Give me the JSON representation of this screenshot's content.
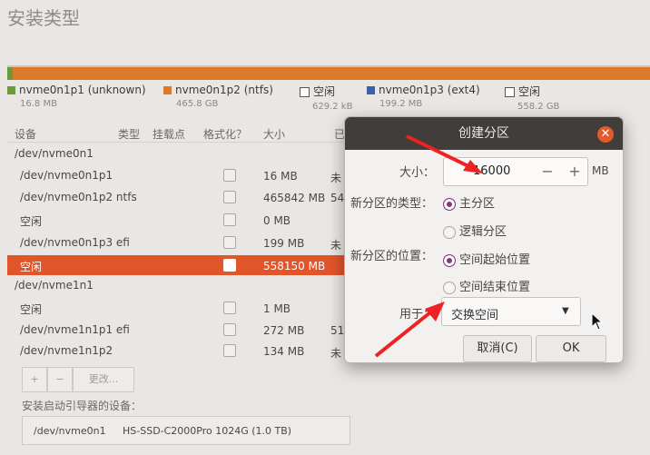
{
  "page": {
    "title": "安装类型"
  },
  "legend": [
    {
      "name": "nvme0n1p1 (unknown)",
      "size": "16.8 MB",
      "color": "#6a9a3a"
    },
    {
      "name": "nvme0n1p2 (ntfs)",
      "size": "465.8 GB",
      "color": "#dd7a2a"
    },
    {
      "name": "空闲",
      "size": "629.2 kB"
    },
    {
      "name": "nvme0n1p3 (ext4)",
      "size": "199.2 MB",
      "color": "#3f5fa8"
    },
    {
      "name": "空闲",
      "size": "558.2 GB"
    }
  ],
  "table": {
    "headers": [
      "设备",
      "类型",
      "挂载点",
      "格式化？",
      "大小",
      "已"
    ],
    "rows": [
      {
        "device": "/dev/nvme0n1",
        "size": "",
        "extra": ""
      },
      {
        "device": "/dev/nvme0n1p1",
        "size": "16 MB",
        "extra": "未"
      },
      {
        "device": "/dev/nvme0n1p2  ntfs",
        "size": "465842 MB",
        "extra": "54"
      },
      {
        "device": "空闲",
        "size": "0 MB",
        "extra": ""
      },
      {
        "device": "/dev/nvme0n1p3  efi",
        "size": "199 MB",
        "extra": "未"
      },
      {
        "device": "空闲",
        "size": "558150 MB",
        "extra": ""
      },
      {
        "device": "/dev/nvme1n1",
        "size": "",
        "extra": ""
      },
      {
        "device": "空闲",
        "size": "1 MB",
        "extra": ""
      },
      {
        "device": "/dev/nvme1n1p1  efi",
        "size": "272 MB",
        "extra": "51"
      },
      {
        "device": "/dev/nvme1n1p2",
        "size": "134 MB",
        "extra": "未"
      }
    ]
  },
  "toolbar": {
    "add": "+",
    "remove": "−",
    "change": "更改..."
  },
  "boot": {
    "label": "安装启动引导器的设备：",
    "device": "/dev/nvme0n1",
    "model": "HS-SSD-C2000Pro 1024G (1.0 TB)"
  },
  "dialog": {
    "title": "创建分区",
    "size_label": "大小：",
    "size_value": "16000",
    "minus": "−",
    "plus": "+",
    "unit": "MB",
    "type_label": "新分区的类型：",
    "type_primary": "主分区",
    "type_logical": "逻辑分区",
    "location_label": "新分区的位置：",
    "location_start": "空间起始位置",
    "location_end": "空间结束位置",
    "use_label": "用于：",
    "use_value": "交换空间",
    "cancel": "取消(C)",
    "ok": "OK"
  }
}
